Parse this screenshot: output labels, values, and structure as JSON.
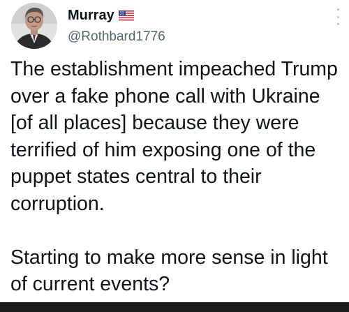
{
  "author": {
    "display_name": "Murray",
    "handle": "@Rothbard1776",
    "avatar_icon": "avatar-photo",
    "flag_icon": "us-flag-icon"
  },
  "tweet": {
    "paragraphs": [
      "The establishment impeached Trump over a fake phone call with Ukraine [of all places] because they were terrified of him exposing one of the puppet states central to their corruption.",
      "Starting to make more sense in light of current events?"
    ]
  },
  "colors": {
    "text": "#0f1419",
    "handle": "#536471",
    "background": "#ffffff",
    "bottom_bar": "#1c1c1c"
  }
}
